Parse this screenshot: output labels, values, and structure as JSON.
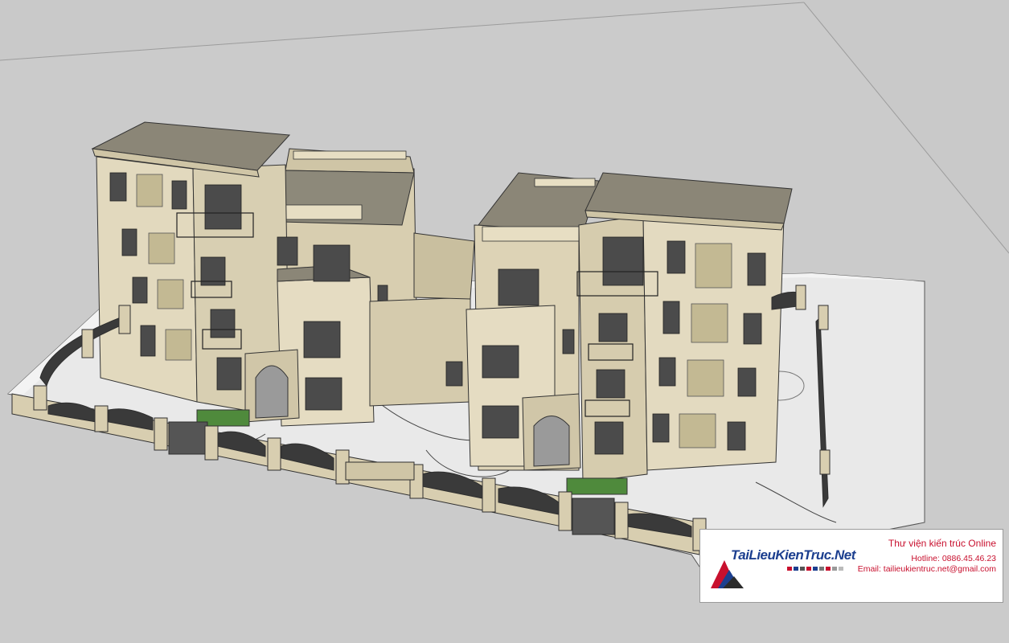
{
  "viewport": {
    "background": "#c9c9c9",
    "ground_color": "#ededed",
    "building_color": "#ddd3b6",
    "roof_color": "#8b8677",
    "trim_color": "#c9bf9f",
    "fence_color": "#3a3a3a"
  },
  "watermark": {
    "brand": "TaiLieuKienTruc.Net",
    "title": "Thư viện kiến trúc Online",
    "hotline": "Hotline: 0886.45.46.23",
    "email": "Email: tailieukientruc.net@gmail.com",
    "accent": "#c8102e",
    "brand_color": "#1c3f8f"
  }
}
